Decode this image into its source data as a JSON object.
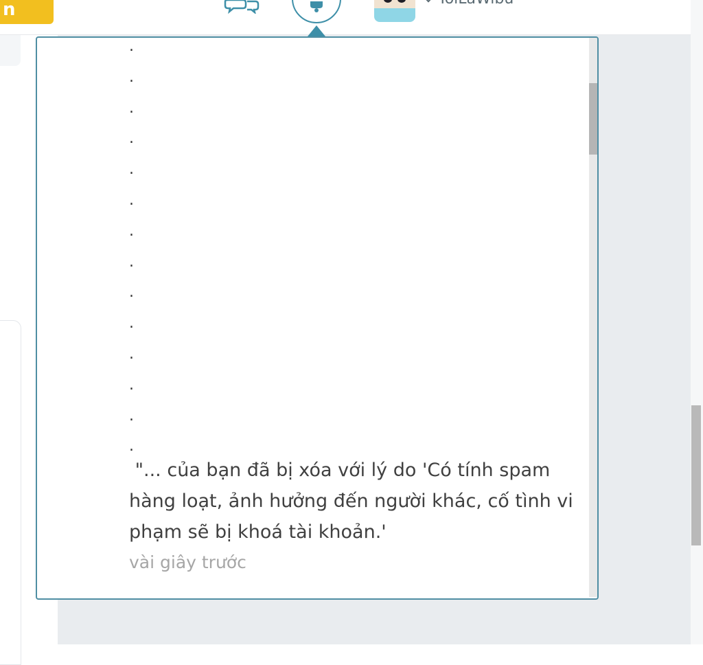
{
  "header": {
    "yellow_button_label": "n",
    "username": "ToiLaWibu"
  },
  "notifications": {
    "dots": [
      ".",
      ".",
      ".",
      ".",
      ".",
      ".",
      ".",
      ".",
      ".",
      ".",
      ".",
      ".",
      ".",
      "."
    ],
    "item": {
      "message": " \"... của bạn đã bị xóa với lý do 'Có tính spam hàng loạt, ảnh hưởng đến người khác, cố tình vi phạm sẽ bị khoá tài khoản.'",
      "time": "vài giây trước"
    }
  },
  "icons": {
    "chat": "chat-bubbles-icon",
    "bell": "bell-icon",
    "chevron": "chevron-down-icon"
  },
  "colors": {
    "accent": "#3e8fa8",
    "yellow": "#f2bf1f",
    "text": "#404040",
    "muted": "#a6a6a6"
  }
}
